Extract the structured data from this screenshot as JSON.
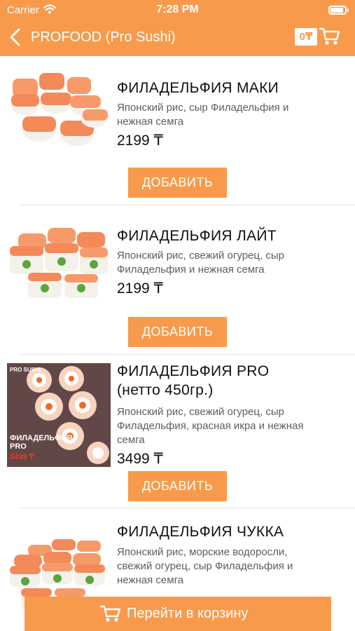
{
  "status_bar": {
    "carrier": "Carrier",
    "time": "7:28 PM"
  },
  "nav": {
    "title": "PROFOOD (Pro Sushi)",
    "cart_total": "0₸"
  },
  "colors": {
    "accent": "#f89a4b",
    "salmon": "#f48a5a",
    "rice": "#f4f1ea",
    "cucumber": "#5aa63d",
    "caviar": "#ee6a1c"
  },
  "products": [
    {
      "name_lines": [
        "ФИЛАДЕЛЬФИЯ МАКИ"
      ],
      "description_lines": [
        "Японский рис, сыр Филадельфия и",
        "нежная семга"
      ],
      "price": "2199 ₸",
      "button": "ДОБАВИТЬ",
      "image_icon": "sushi-roll-image"
    },
    {
      "name_lines": [
        "ФИЛАДЕЛЬФИЯ ЛАЙТ"
      ],
      "description_lines": [
        "Японский рис, свежий огурец, сыр",
        "Филадельфия и нежная семга"
      ],
      "price": "2199 ₸",
      "button": "ДОБАВИТЬ",
      "image_icon": "sushi-roll-image"
    },
    {
      "name_lines": [
        "ФИЛАДЕЛЬФИЯ PRO",
        "(нетто 450гр.)"
      ],
      "description_lines": [
        "Японский рис, свежий огурец, сыр",
        "Филадельфия, красная икра и нежная",
        "семга"
      ],
      "price": "3499 ₸",
      "button": "ДОБАВИТЬ",
      "image_icon": "sushi-promo-image",
      "image_text": {
        "brand": "PRO SUSHI",
        "line1": "ФИЛАДЕЛЬФИЯ",
        "line2": "PRO",
        "price": "3499 ₸"
      }
    },
    {
      "name_lines": [
        "ФИЛАДЕЛЬФИЯ ЧУККА"
      ],
      "description_lines": [
        "Японский рис, морские водоросли,",
        "свежий огурец, сыр Филадельфия и",
        "нежная семга"
      ],
      "image_icon": "sushi-roll-image"
    }
  ],
  "footer": {
    "go_to_cart": "Перейти в корзину"
  }
}
